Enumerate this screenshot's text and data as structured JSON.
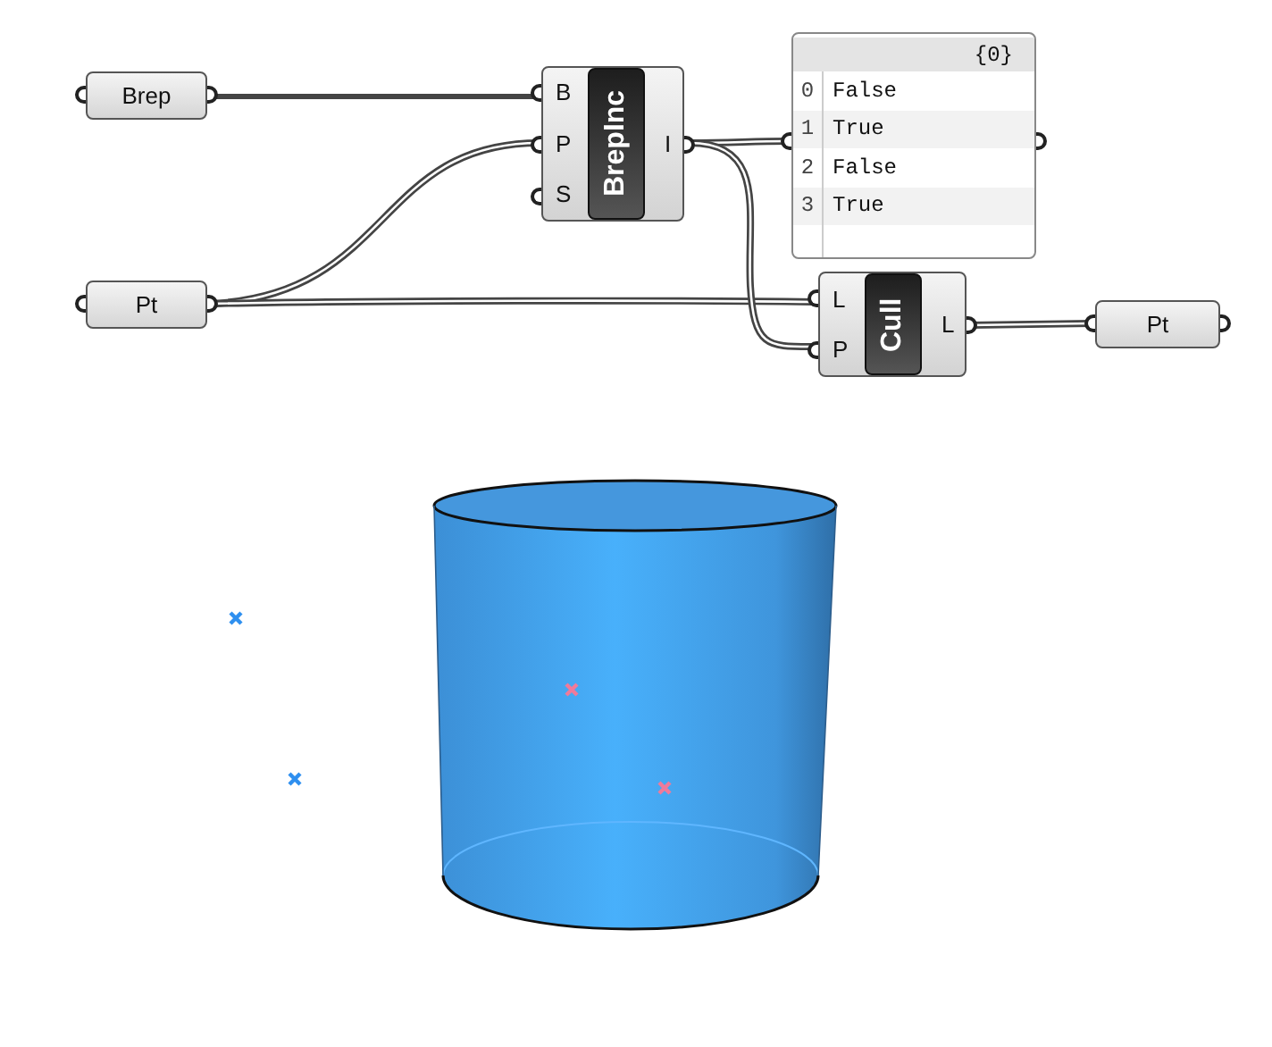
{
  "nodes": [
    {
      "kind": "param",
      "label": "Brep"
    },
    {
      "kind": "param",
      "label": "Pt"
    },
    {
      "kind": "component",
      "label": "BrepInc",
      "inputs": [
        "B",
        "P",
        "S"
      ],
      "outputs": [
        "I"
      ]
    },
    {
      "kind": "panel",
      "header": "{0}",
      "rows": [
        {
          "index": "0",
          "value": "False"
        },
        {
          "index": "1",
          "value": "True"
        },
        {
          "index": "2",
          "value": "False"
        },
        {
          "index": "3",
          "value": "True"
        }
      ]
    },
    {
      "kind": "component",
      "label": "Cull",
      "inputs": [
        "L",
        "P"
      ],
      "outputs": [
        "L"
      ]
    },
    {
      "kind": "param",
      "label": "Pt"
    }
  ],
  "viewport": {
    "points": [
      {
        "color": "#2e8fef"
      },
      {
        "color": "#2e8fef"
      },
      {
        "color": "#f07a9a"
      },
      {
        "color": "#f07a9a"
      }
    ]
  }
}
